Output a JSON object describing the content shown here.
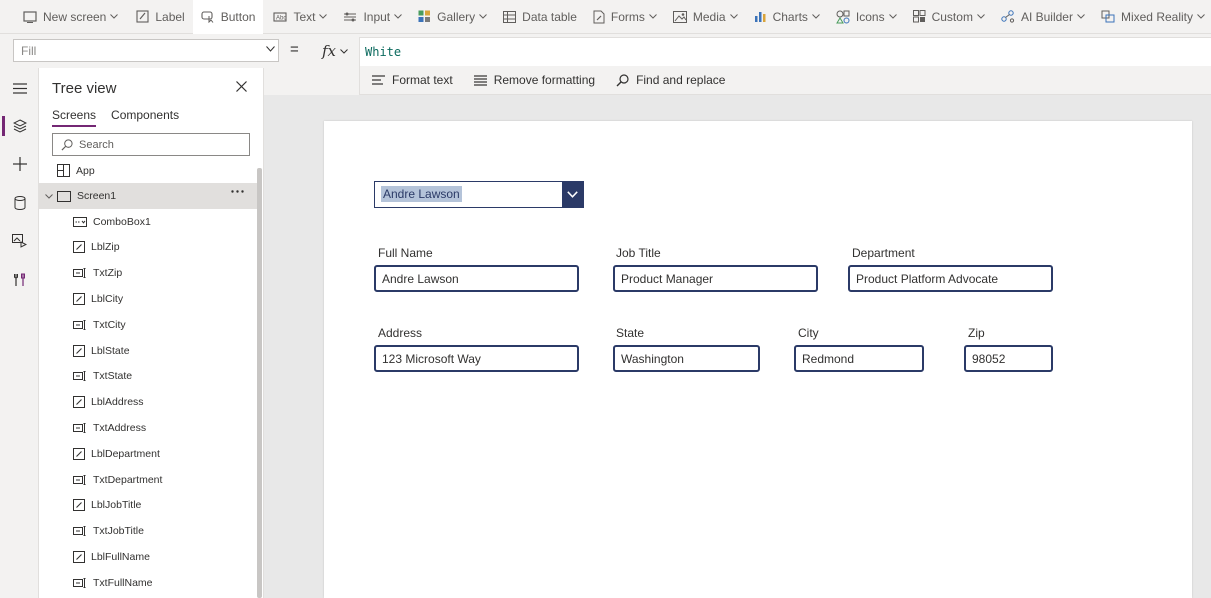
{
  "ribbon": {
    "items": [
      {
        "label": "New screen"
      },
      {
        "label": "Label"
      },
      {
        "label": "Button"
      },
      {
        "label": "Text"
      },
      {
        "label": "Input"
      },
      {
        "label": "Gallery"
      },
      {
        "label": "Data table"
      },
      {
        "label": "Forms"
      },
      {
        "label": "Media"
      },
      {
        "label": "Charts"
      },
      {
        "label": "Icons"
      },
      {
        "label": "Custom"
      },
      {
        "label": "AI Builder"
      },
      {
        "label": "Mixed Reality"
      }
    ]
  },
  "formula_bar": {
    "property": "Fill",
    "equals": "=",
    "fx": "fx",
    "formula": "White"
  },
  "format_toolbar": {
    "format_text": "Format text",
    "remove_formatting": "Remove formatting",
    "find_replace": "Find and replace"
  },
  "tree": {
    "title": "Tree view",
    "tabs": [
      "Screens",
      "Components"
    ],
    "search_placeholder": "Search",
    "app_label": "App",
    "screen_label": "Screen1",
    "children": [
      {
        "label": "ComboBox1",
        "icon": "combobox-icon"
      },
      {
        "label": "LblZip",
        "icon": "label-icon"
      },
      {
        "label": "TxtZip",
        "icon": "textinput-icon"
      },
      {
        "label": "LblCity",
        "icon": "label-icon"
      },
      {
        "label": "TxtCity",
        "icon": "textinput-icon"
      },
      {
        "label": "LblState",
        "icon": "label-icon"
      },
      {
        "label": "TxtState",
        "icon": "textinput-icon"
      },
      {
        "label": "LblAddress",
        "icon": "label-icon"
      },
      {
        "label": "TxtAddress",
        "icon": "textinput-icon"
      },
      {
        "label": "LblDepartment",
        "icon": "label-icon"
      },
      {
        "label": "TxtDepartment",
        "icon": "textinput-icon"
      },
      {
        "label": "LblJobTitle",
        "icon": "label-icon"
      },
      {
        "label": "TxtJobTitle",
        "icon": "textinput-icon"
      },
      {
        "label": "LblFullName",
        "icon": "label-icon"
      },
      {
        "label": "TxtFullName",
        "icon": "textinput-icon"
      }
    ]
  },
  "canvas": {
    "combo_value": "Andre Lawson",
    "fields": {
      "full_name": {
        "label": "Full Name",
        "value": "Andre Lawson"
      },
      "job_title": {
        "label": "Job Title",
        "value": "Product Manager"
      },
      "department": {
        "label": "Department",
        "value": "Product Platform Advocate"
      },
      "address": {
        "label": "Address",
        "value": "123 Microsoft Way"
      },
      "state": {
        "label": "State",
        "value": "Washington"
      },
      "city": {
        "label": "City",
        "value": "Redmond"
      },
      "zip": {
        "label": "Zip",
        "value": "98052"
      }
    }
  },
  "colors": {
    "accent": "#742774",
    "field_border": "#2b3a67",
    "selection": "#b4c3d9",
    "formula_text": "#0b6a5e"
  }
}
